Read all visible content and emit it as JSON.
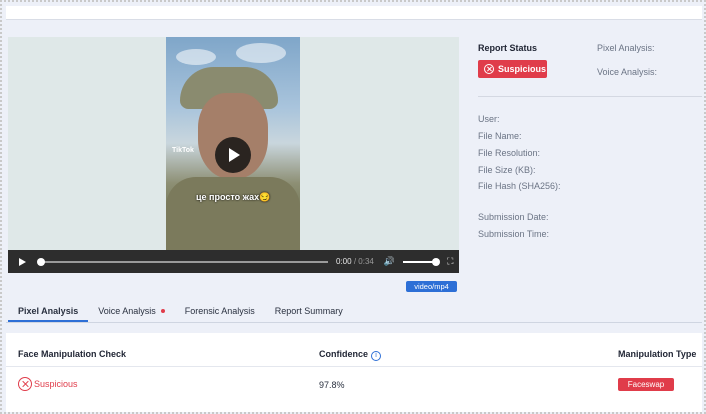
{
  "video": {
    "overlay_brand": "TikTok",
    "caption": "це просто жах😏",
    "time_current": "0:00",
    "time_separator": "/",
    "time_total": "0:34",
    "mime": "video/mp4"
  },
  "report": {
    "status_title": "Report Status",
    "status_value": "Suspicious",
    "pixel_analysis_label": "Pixel Analysis:",
    "voice_analysis_label": "Voice Analysis:",
    "fields": [
      "User:",
      "File Name:",
      "File Resolution:",
      "File Size (KB):",
      "File Hash (SHA256):"
    ],
    "date_fields": [
      "Submission Date:",
      "Submission Time:"
    ]
  },
  "tabs": [
    "Pixel Analysis",
    "Voice Analysis",
    "Forensic Analysis",
    "Report Summary"
  ],
  "table": {
    "headers": [
      "Face Manipulation Check",
      "Confidence",
      "Manipulation Type"
    ],
    "row": {
      "check": "Suspicious",
      "confidence": "97.8%",
      "type": "Faceswap"
    }
  },
  "colors": {
    "accent": "#2d6fd6",
    "danger": "#e03c4a",
    "panel": "#edf0f8"
  }
}
